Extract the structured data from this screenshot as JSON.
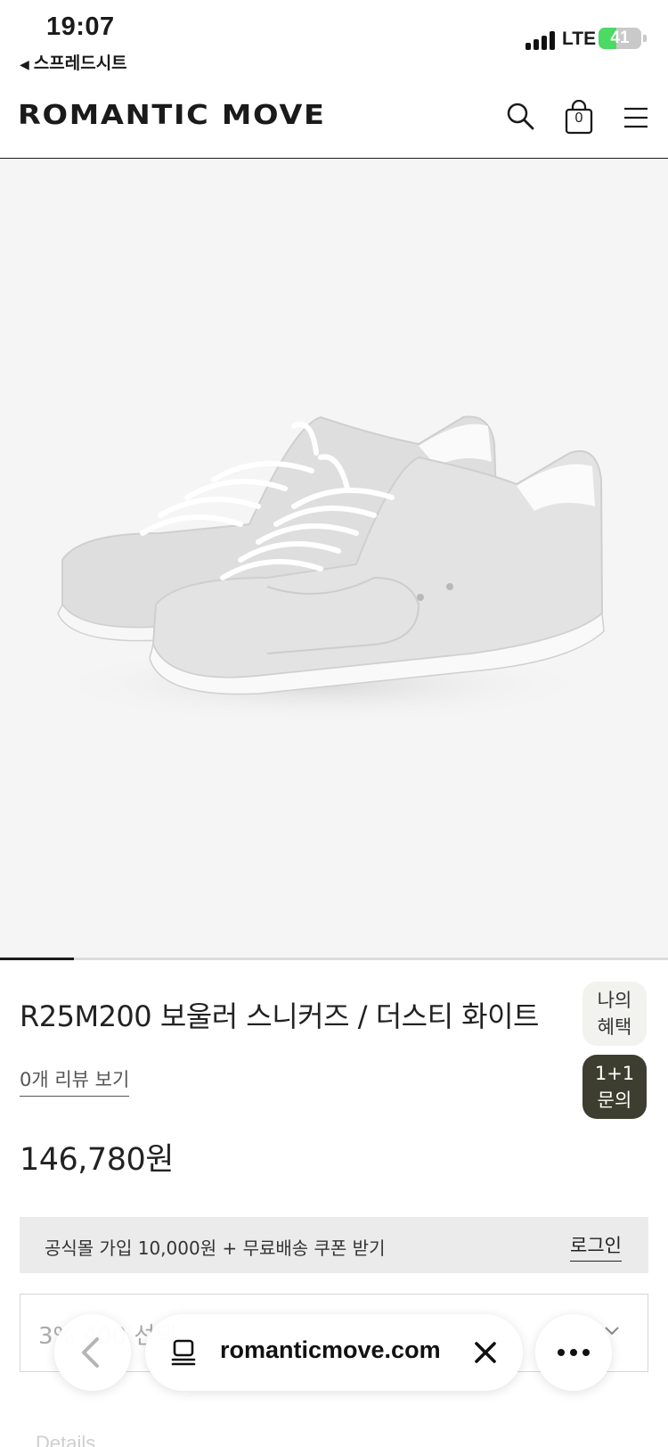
{
  "status_bar": {
    "time": "19:07",
    "back_app": "스프레드시트",
    "network": "LTE",
    "battery_level": "41",
    "battery_fraction": 0.41
  },
  "header": {
    "logo": "ROMANTIC MOVE",
    "cart_count": "0",
    "icons": [
      "search-icon",
      "shopping-bag-icon",
      "menu-icon"
    ]
  },
  "gallery": {
    "image_alt": "white suede sneakers",
    "progress_fraction": 0.11
  },
  "product": {
    "title": "R25M200 보울러 스니커즈 / 더스티 화이트",
    "review_link": "0개 리뷰 보기",
    "price": "146,780원"
  },
  "floating": {
    "benefit_line1": "나의",
    "benefit_line2": "혜택",
    "inquiry_line1": "1+1",
    "inquiry_line2": "문의"
  },
  "coupon": {
    "text": "공식몰 가입 10,000원 + 무료배송 쿠폰 받기",
    "login": "로그인"
  },
  "option_select": {
    "text": "3% 400 선택"
  },
  "faded_text": "Details",
  "browser": {
    "url": "romanticmove.com",
    "icons": [
      "back-icon",
      "tabs-icon",
      "close-icon",
      "more-icon"
    ]
  },
  "colors": {
    "accent_dark": "#3e3e30",
    "battery_green": "#4cd964",
    "image_bg": "#f5f5f5"
  }
}
